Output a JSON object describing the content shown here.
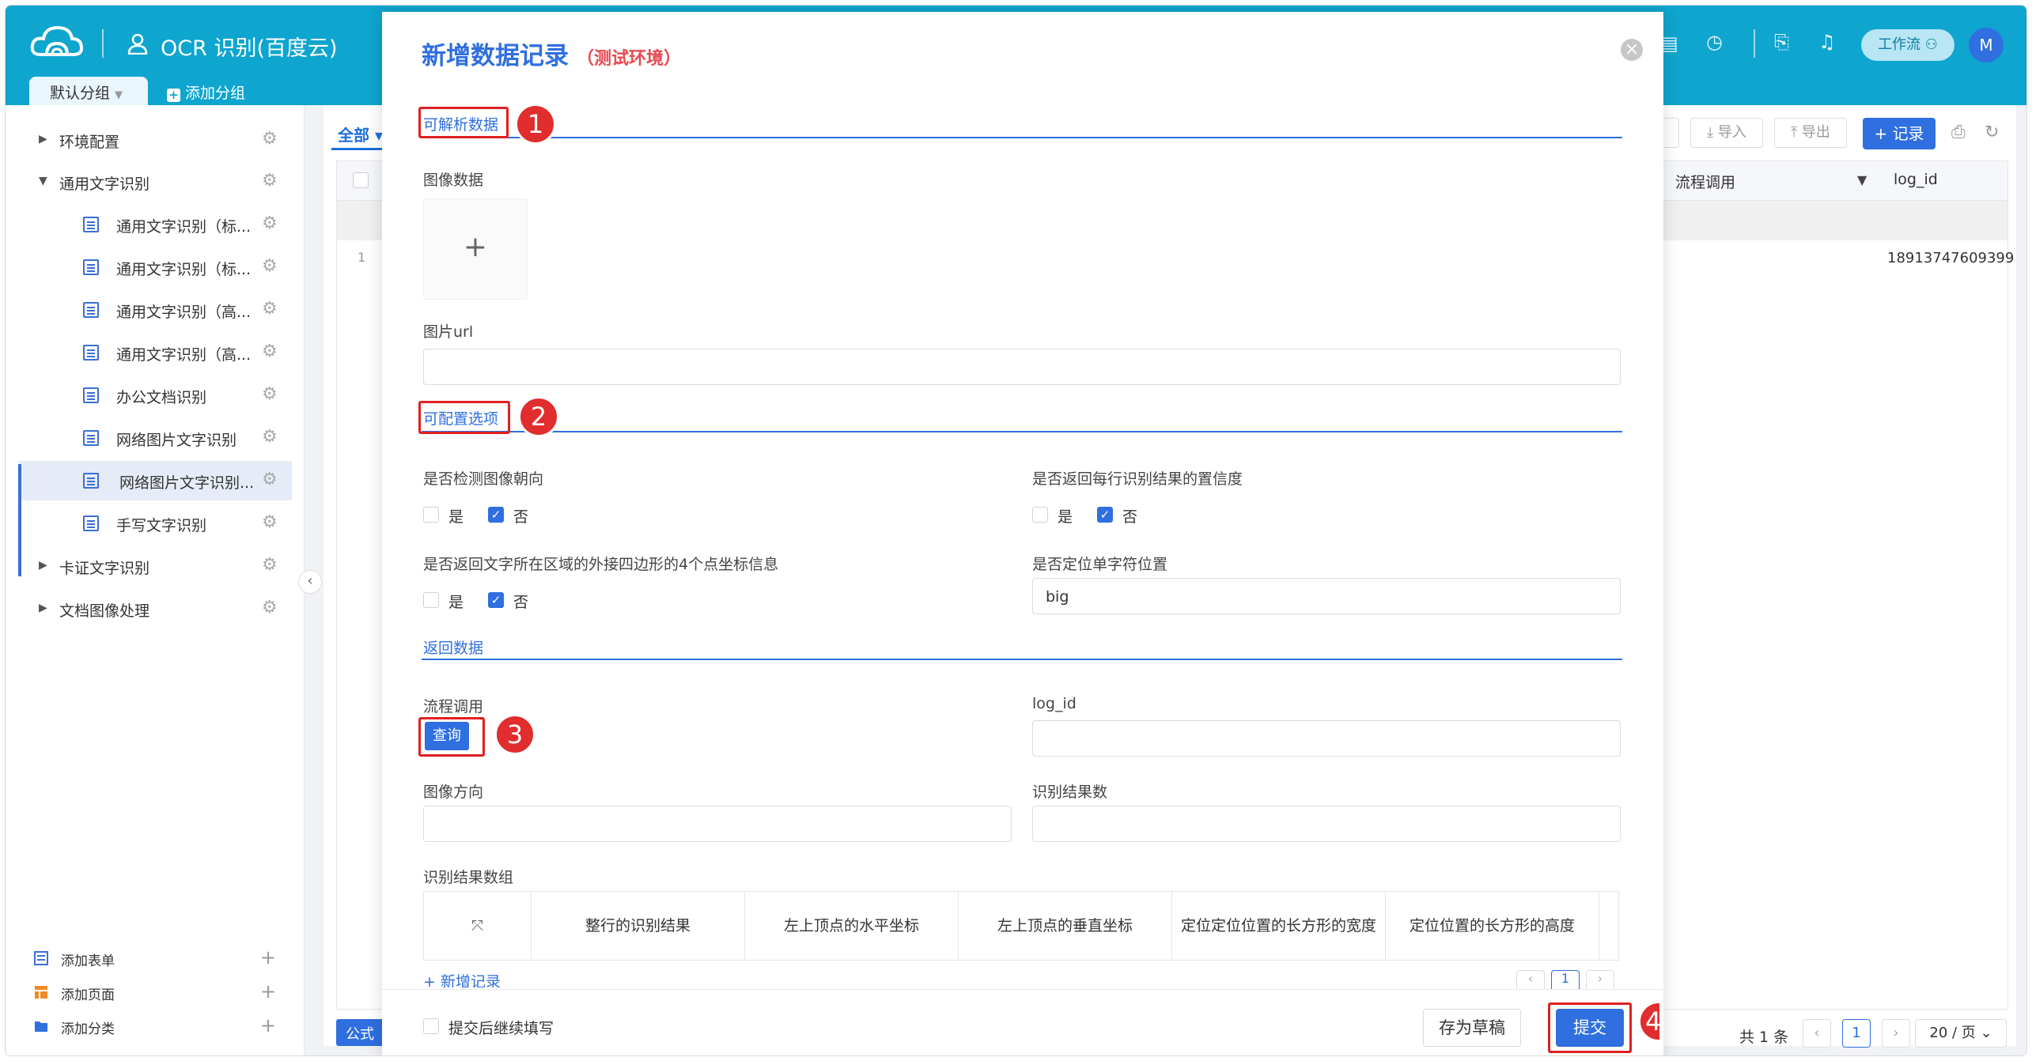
{
  "header": {
    "app_title": "OCR 识别(百度云)",
    "tab_default": "默认分组",
    "tab_add": "添加分组",
    "workflow_label": "工作流",
    "avatar_letter": "M",
    "icons": [
      "cloud-logo-icon",
      "user-icon",
      "document-icon",
      "clock-icon",
      "clipboard-icon",
      "bell-icon"
    ],
    "brand_color": "#0ea5cf"
  },
  "sidebar": {
    "groups": [
      {
        "label": "环境配置"
      },
      {
        "label": "通用文字识别"
      }
    ],
    "children": [
      {
        "label": "通用文字识别（标..."
      },
      {
        "label": "通用文字识别（标..."
      },
      {
        "label": "通用文字识别（高..."
      },
      {
        "label": "通用文字识别（高..."
      },
      {
        "label": "办公文档识别"
      },
      {
        "label": "网络图片文字识别"
      },
      {
        "label": "网络图片文字识别..."
      },
      {
        "label": "手写文字识别"
      }
    ],
    "groups_after": [
      {
        "label": "卡证文字识别"
      },
      {
        "label": "文档图像处理"
      }
    ],
    "bottom": [
      {
        "label": "添加表单"
      },
      {
        "label": "添加页面"
      },
      {
        "label": "添加分类"
      }
    ]
  },
  "background": {
    "filter_all": "全部",
    "import_label": "导入",
    "export_label": "导出",
    "record_label": "记录",
    "col_flow": "流程调用",
    "col_log": "log_id",
    "row_num": "1",
    "row_log": "18913747609399",
    "formula_label": "公式",
    "total": "共 1 条",
    "page_current": "1",
    "page_size": "20 / 页"
  },
  "modal": {
    "title": "新增数据记录",
    "subtitle": "（测试环境）",
    "section_parse": "可解析数据",
    "image_label": "图像数据",
    "url_label": "图片url",
    "url_value": "",
    "section_config": "可配置选项",
    "q_detect_direction": "是否检测图像朝向",
    "q_return_prob": "是否返回每行识别结果的置信度",
    "q_vertexes": "是否返回文字所在区域的外接四边形的4个点坐标信息",
    "q_char_position": "是否定位单字符位置",
    "char_position_value": "big",
    "yes": "是",
    "no": "否",
    "section_return": "返回数据",
    "flow_label": "流程调用",
    "query_label": "查询",
    "log_id_label": "log_id",
    "direction_label": "图像方向",
    "result_num_label": "识别结果数",
    "result_array_label": "识别结果数组",
    "table_headers": [
      "整行的识别结果",
      "左上顶点的水平坐标",
      "左上顶点的垂直坐标",
      "定位定位位置的长方形的宽度",
      "定位位置的长方形的高度"
    ],
    "add_record": "+ 新增记录",
    "continue_label": "提交后继续填写",
    "draft_label": "存为草稿",
    "submit_label": "提交",
    "accent_color": "#2f6fe0",
    "badges": [
      "1",
      "2",
      "3",
      "4"
    ]
  }
}
